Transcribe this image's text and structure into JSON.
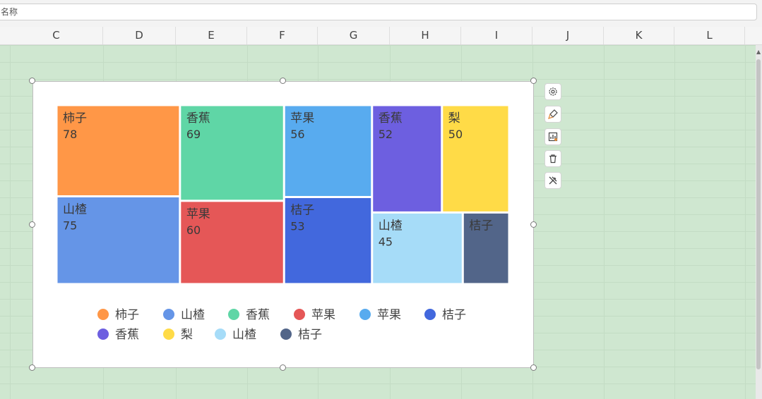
{
  "name_box": {
    "placeholder": "名称"
  },
  "columns": [
    "C",
    "D",
    "E",
    "F",
    "G",
    "H",
    "I",
    "J",
    "K",
    "L"
  ],
  "toolbar": {
    "icons": [
      "gear-icon",
      "brush-icon",
      "chart-switch-icon",
      "trash-icon",
      "tools-icon"
    ]
  },
  "chart_data": {
    "type": "treemap",
    "items": [
      {
        "name": "柿子",
        "value": 78,
        "color": "#ff9747"
      },
      {
        "name": "山楂",
        "value": 75,
        "color": "#6595e7"
      },
      {
        "name": "香蕉",
        "value": 69,
        "color": "#5fd6a6"
      },
      {
        "name": "苹果",
        "value": 60,
        "color": "#e55757"
      },
      {
        "name": "苹果",
        "value": 56,
        "color": "#58abef"
      },
      {
        "name": "桔子",
        "value": 53,
        "color": "#4268dd"
      },
      {
        "name": "香蕉",
        "value": 52,
        "color": "#6d5fe0"
      },
      {
        "name": "梨",
        "value": 50,
        "color": "#ffdb47"
      },
      {
        "name": "山楂",
        "value": 45,
        "color": "#a6dcf8"
      },
      {
        "name": "桔子",
        "value": "",
        "color": "#526589"
      }
    ],
    "legend": [
      "柿子",
      "山楂",
      "香蕉",
      "苹果",
      "苹果",
      "桔子",
      "香蕉",
      "梨",
      "山楂",
      "桔子"
    ],
    "legend_position": "bottom"
  }
}
